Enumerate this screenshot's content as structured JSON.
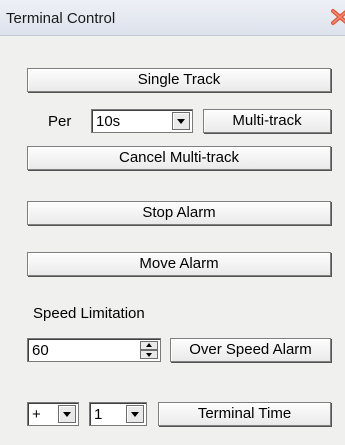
{
  "window": {
    "title": "Terminal Control",
    "close_icon": "close-x-icon",
    "close_icon_color": "#e0553b"
  },
  "buttons": {
    "single_track": "Single Track",
    "multi_track": "Multi-track",
    "cancel_multi_track": "Cancel Multi-track",
    "stop_alarm": "Stop Alarm",
    "move_alarm": "Move Alarm",
    "over_speed_alarm": "Over Speed Alarm",
    "terminal_time": "Terminal Time"
  },
  "per": {
    "label": "Per",
    "interval_value": "10s"
  },
  "speed": {
    "label": "Speed Limitation",
    "value": "60"
  },
  "time": {
    "sign_value": "+",
    "offset_value": "1"
  }
}
